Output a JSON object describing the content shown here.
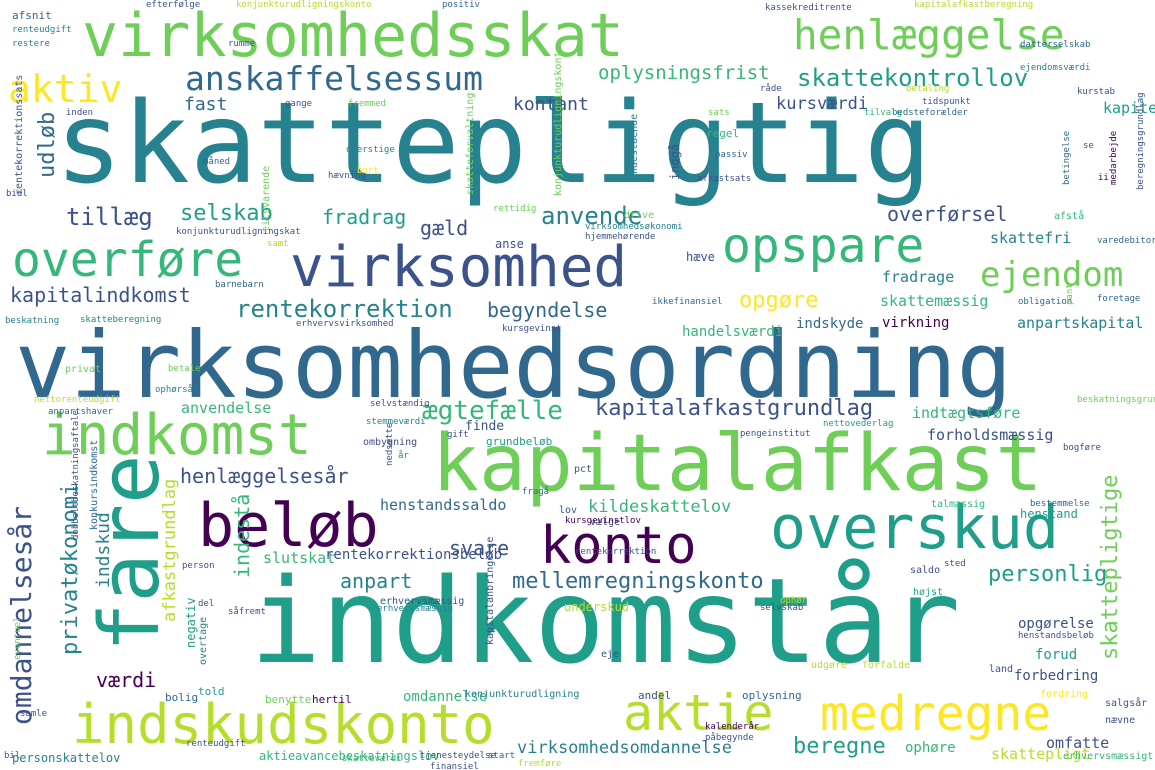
{
  "palette": {
    "dark_purple": "#440154",
    "indigo": "#3b528b",
    "blue": "#31688e",
    "teal": "#26828e",
    "teal_green": "#1f9e89",
    "green": "#35b779",
    "light_green": "#6ece58",
    "lime": "#b5de2b",
    "yellow": "#fde725"
  },
  "words": [
    {
      "text": "skattepligtig",
      "color": "#26828e"
    },
    {
      "text": "virksomhedsordning",
      "color": "#31688e"
    },
    {
      "text": "indkomstår",
      "color": "#1f9e89"
    },
    {
      "text": "kapitalafkast",
      "color": "#6ece58"
    },
    {
      "text": "virksomhedsskat",
      "color": "#6ece58"
    },
    {
      "text": "virksomhed",
      "color": "#3b528b"
    },
    {
      "text": "henlæggelse",
      "color": "#6ece58"
    },
    {
      "text": "anskaffelsessum",
      "color": "#31688e"
    },
    {
      "text": "overføre",
      "color": "#35b779"
    },
    {
      "text": "opspare",
      "color": "#35b779"
    },
    {
      "text": "indkomst",
      "color": "#6ece58"
    },
    {
      "text": "fare",
      "color": "#1f9e89"
    },
    {
      "text": "beløb",
      "color": "#440154"
    },
    {
      "text": "konto",
      "color": "#440154"
    },
    {
      "text": "overskud",
      "color": "#1f9e89"
    },
    {
      "text": "indskudskonto",
      "color": "#b5de2b"
    },
    {
      "text": "aktie",
      "color": "#b5de2b"
    },
    {
      "text": "medregne",
      "color": "#fde725"
    },
    {
      "text": "aktiv",
      "color": "#fde725"
    },
    {
      "text": "ejendom",
      "color": "#6ece58"
    },
    {
      "text": "skattekontrollov",
      "color": "#1f9e89"
    },
    {
      "text": "oplysningsfrist",
      "color": "#35b779"
    },
    {
      "text": "kontant",
      "color": "#3b528b"
    },
    {
      "text": "fast",
      "color": "#31688e"
    },
    {
      "text": "kursværdi",
      "color": "#3b528b"
    },
    {
      "text": "kapitel",
      "color": "#1f9e89"
    },
    {
      "text": "udløb",
      "color": "#31688e"
    },
    {
      "text": "tillæg",
      "color": "#3b528b"
    },
    {
      "text": "selskab",
      "color": "#1f9e89"
    },
    {
      "text": "fradrag",
      "color": "#1f9e89"
    },
    {
      "text": "gæld",
      "color": "#3b528b"
    },
    {
      "text": "anvende",
      "color": "#26828e"
    },
    {
      "text": "overførsel",
      "color": "#3b528b"
    },
    {
      "text": "skattefri",
      "color": "#26828e"
    },
    {
      "text": "kapitalindkomst",
      "color": "#3b528b"
    },
    {
      "text": "rentekorrektion",
      "color": "#26828e"
    },
    {
      "text": "begyndelse",
      "color": "#31688e"
    },
    {
      "text": "opgøre",
      "color": "#fde725"
    },
    {
      "text": "skattemæssig",
      "color": "#35b779"
    },
    {
      "text": "fradrage",
      "color": "#26828e"
    },
    {
      "text": "anpartskapital",
      "color": "#26828e"
    },
    {
      "text": "handelsværdi",
      "color": "#35b779"
    },
    {
      "text": "indskyde",
      "color": "#31688e"
    },
    {
      "text": "virkning",
      "color": "#440154"
    },
    {
      "text": "ægtefælle",
      "color": "#35b779"
    },
    {
      "text": "kapitalafkastgrundlag",
      "color": "#3b528b"
    },
    {
      "text": "indtægtsføre",
      "color": "#35b779"
    },
    {
      "text": "forholdsmæssig",
      "color": "#3b528b"
    },
    {
      "text": "anvendelse",
      "color": "#35b779"
    },
    {
      "text": "henlæggelsesår",
      "color": "#3b528b"
    },
    {
      "text": "omdannelsesår",
      "color": "#3b528b"
    },
    {
      "text": "privatøkonomi",
      "color": "#26828e"
    },
    {
      "text": "indskud",
      "color": "#26828e"
    },
    {
      "text": "afkastgrundlag",
      "color": "#b5de2b"
    },
    {
      "text": "svare",
      "color": "#3b528b"
    },
    {
      "text": "anpart",
      "color": "#26828e"
    },
    {
      "text": "mellemregningskonto",
      "color": "#31688e"
    },
    {
      "text": "personlig",
      "color": "#1f9e89"
    },
    {
      "text": "skattepligtige",
      "color": "#6ece58"
    },
    {
      "text": "henstandssaldo",
      "color": "#31688e"
    },
    {
      "text": "kildeskattelov",
      "color": "#35b779"
    },
    {
      "text": "slutskat",
      "color": "#35b779"
    },
    {
      "text": "rentekorrektionsbeløb",
      "color": "#3b528b"
    },
    {
      "text": "indestå",
      "color": "#35b779"
    },
    {
      "text": "værdi",
      "color": "#440154"
    },
    {
      "text": "beregne",
      "color": "#1f9e89"
    },
    {
      "text": "virksomhedsomdannelse",
      "color": "#26828e"
    },
    {
      "text": "omfatte",
      "color": "#3b528b"
    },
    {
      "text": "ophøre",
      "color": "#35b779"
    },
    {
      "text": "skattepligt",
      "color": "#b5de2b"
    },
    {
      "text": "opgørelse",
      "color": "#3b528b"
    },
    {
      "text": "forud",
      "color": "#1f9e89"
    },
    {
      "text": "forbedring",
      "color": "#3b528b"
    },
    {
      "text": "omdannelse",
      "color": "#35b779"
    },
    {
      "text": "aktieavancebeskatningslov",
      "color": "#35b779"
    },
    {
      "text": "personskattelov",
      "color": "#26828e"
    },
    {
      "text": "tjenesteydelse",
      "color": "#3b528b"
    },
    {
      "text": "finansiel",
      "color": "#3b528b"
    },
    {
      "text": "kalenderår",
      "color": "#440154"
    },
    {
      "text": "påbegynde",
      "color": "#3b528b"
    },
    {
      "text": "underskud",
      "color": "#b5de2b"
    },
    {
      "text": "udgøre",
      "color": "#b5de2b"
    },
    {
      "text": "forfalde",
      "color": "#b5de2b"
    },
    {
      "text": "andel",
      "color": "#3b528b"
    },
    {
      "text": "oplysning",
      "color": "#31688e"
    },
    {
      "text": "hertil",
      "color": "#440154"
    },
    {
      "text": "benytte",
      "color": "#6ece58"
    },
    {
      "text": "bolig",
      "color": "#31688e"
    },
    {
      "text": "told",
      "color": "#1f9e89"
    },
    {
      "text": "negativ",
      "color": "#1f9e89"
    },
    {
      "text": "overtage",
      "color": "#26828e"
    },
    {
      "text": "konjunkturudligning",
      "color": "#26828e"
    },
    {
      "text": "kapitalanbringelse",
      "color": "#3b528b"
    },
    {
      "text": "erhvervsmæssig",
      "color": "#3b528b"
    },
    {
      "text": "eje",
      "color": "#3b528b"
    },
    {
      "text": "land",
      "color": "#3b528b"
    },
    {
      "text": "salgsår",
      "color": "#3b528b"
    },
    {
      "text": "nævne",
      "color": "#3b528b"
    },
    {
      "text": "erhvervsmæssigt",
      "color": "#35b779"
    },
    {
      "text": "fordring",
      "color": "#fde725"
    },
    {
      "text": "højst",
      "color": "#1f9e89"
    },
    {
      "text": "saldo",
      "color": "#3b528b"
    },
    {
      "text": "henstandsbeløb",
      "color": "#3b528b"
    },
    {
      "text": "henstand",
      "color": "#1f9e89"
    },
    {
      "text": "talmæssig",
      "color": "#35b779"
    },
    {
      "text": "bestemmelse",
      "color": "#31688e"
    },
    {
      "text": "vælge",
      "color": "#3b528b"
    },
    {
      "text": "kursgevinstlov",
      "color": "#440154"
    },
    {
      "text": "lov",
      "color": "#3b528b"
    },
    {
      "text": "pct",
      "color": "#3b528b"
    },
    {
      "text": "fragå",
      "color": "#31688e"
    },
    {
      "text": "finde",
      "color": "#3b528b"
    },
    {
      "text": "grundbeløb",
      "color": "#1f9e89"
    },
    {
      "text": "ombygning",
      "color": "#3b528b"
    },
    {
      "text": "gift",
      "color": "#3b528b"
    },
    {
      "text": "stemmeværdi",
      "color": "#26828e"
    },
    {
      "text": "selvstændig",
      "color": "#3b528b"
    },
    {
      "text": "nettovederlag",
      "color": "#1f9e89"
    },
    {
      "text": "pengeinstitut",
      "color": "#3b528b"
    },
    {
      "text": "bogføre",
      "color": "#3b528b"
    },
    {
      "text": "anse",
      "color": "#3b528b"
    },
    {
      "text": "hæve",
      "color": "#3b528b"
    },
    {
      "text": "ikkefinansiel",
      "color": "#31688e"
    },
    {
      "text": "erhvervsvirksomhed",
      "color": "#3b528b"
    },
    {
      "text": "kursgevinst",
      "color": "#3b528b"
    },
    {
      "text": "barnebarn",
      "color": "#31688e"
    },
    {
      "text": "beskatning",
      "color": "#26828e"
    },
    {
      "text": "skatteberegning",
      "color": "#26828e"
    },
    {
      "text": "betale",
      "color": "#6ece58"
    },
    {
      "text": "privat",
      "color": "#6ece58"
    },
    {
      "text": "ophørsår",
      "color": "#26828e"
    },
    {
      "text": "nettorenteudgift",
      "color": "#b5de2b"
    },
    {
      "text": "anpartshaver",
      "color": "#31688e"
    },
    {
      "text": "obligation",
      "color": "#31688e"
    },
    {
      "text": "foretage",
      "color": "#31688e"
    },
    {
      "text": "varedebitor",
      "color": "#31688e"
    },
    {
      "text": "afstå",
      "color": "#35b779"
    },
    {
      "text": "virksomhedsøkonomi",
      "color": "#26828e"
    },
    {
      "text": "hjemmehørende",
      "color": "#3b528b"
    },
    {
      "text": "konjunkturudligningskat",
      "color": "#3b528b"
    },
    {
      "text": "drive",
      "color": "#6ece58"
    },
    {
      "text": "rettidig",
      "color": "#6ece58"
    },
    {
      "text": "tilsvarende",
      "color": "#6ece58"
    },
    {
      "text": "samt",
      "color": "#b5de2b"
    },
    {
      "text": "hævning",
      "color": "#3b528b"
    },
    {
      "text": "bort",
      "color": "#fde725"
    },
    {
      "text": "overstige",
      "color": "#26828e"
    },
    {
      "text": "måned",
      "color": "#31688e"
    },
    {
      "text": "passiv",
      "color": "#31688e"
    },
    {
      "text": "afkastsats",
      "color": "#3b528b"
    },
    {
      "text": "regel",
      "color": "#35b779"
    },
    {
      "text": "indestående",
      "color": "#26828e"
    },
    {
      "text": "efterfølge",
      "color": "#3b528b"
    },
    {
      "text": "konjunkturudligningskonto",
      "color": "#b5de2b"
    },
    {
      "text": "positiv",
      "color": "#31688e"
    },
    {
      "text": "kassekreditrente",
      "color": "#3b528b"
    },
    {
      "text": "kapitalafkastberegning",
      "color": "#b5de2b"
    },
    {
      "text": "afsnit",
      "color": "#31688e"
    },
    {
      "text": "renteudgift",
      "color": "#26828e"
    },
    {
      "text": "restere",
      "color": "#26828e"
    },
    {
      "text": "rumme",
      "color": "#3b528b"
    },
    {
      "text": "datterselskab",
      "color": "#31688e"
    },
    {
      "text": "ejendomsværdi",
      "color": "#26828e"
    },
    {
      "text": "råde",
      "color": "#3b528b"
    },
    {
      "text": "kurstab",
      "color": "#3b528b"
    },
    {
      "text": "betaling",
      "color": "#b5de2b"
    },
    {
      "text": "tidspunkt",
      "color": "#3b528b"
    },
    {
      "text": "bedsteforælder",
      "color": "#31688e"
    },
    {
      "text": "tilvalg",
      "color": "#35b779"
    },
    {
      "text": "sats",
      "color": "#6ece58"
    },
    {
      "text": "fremmed",
      "color": "#6ece58"
    },
    {
      "text": "gange",
      "color": "#3b528b"
    },
    {
      "text": "inden",
      "color": "#3b528b"
    },
    {
      "text": "rentekorrektionssats",
      "color": "#3b528b"
    },
    {
      "text": "skatteforvaltning",
      "color": "#6ece58"
    },
    {
      "text": "konjunkturudligningskonto",
      "color": "#6ece58"
    },
    {
      "text": "beregningsgrundlag",
      "color": "#3b528b"
    },
    {
      "text": "medarbejde",
      "color": "#440154"
    },
    {
      "text": "ii",
      "color": "#440154"
    },
    {
      "text": "se",
      "color": "#3b528b"
    },
    {
      "text": "indgå",
      "color": "#3b528b"
    },
    {
      "text": "betingelse",
      "color": "#31688e"
    },
    {
      "text": "bidl",
      "color": "#3b528b"
    },
    {
      "text": "pant",
      "color": "#6ece58"
    },
    {
      "text": "beskatningsgrundlagsordning",
      "color": "#6ece58"
    },
    {
      "text": "rentekorrektion",
      "color": "#3b528b"
    },
    {
      "text": "sted",
      "color": "#3b528b"
    },
    {
      "text": "person",
      "color": "#3b528b"
    },
    {
      "text": "del",
      "color": "#3b528b"
    },
    {
      "text": "såfremt",
      "color": "#3b528b"
    },
    {
      "text": "selvskab",
      "color": "#3b528b"
    },
    {
      "text": "ophør",
      "color": "#b5de2b"
    },
    {
      "text": "eventuel",
      "color": "#6ece58"
    },
    {
      "text": "samle",
      "color": "#3b528b"
    },
    {
      "text": "bil",
      "color": "#3b528b"
    },
    {
      "text": "nedsætte",
      "color": "#3b528b"
    },
    {
      "text": "år",
      "color": "#26828e"
    },
    {
      "text": "dobbeltbeskatningsaftale",
      "color": "#3b528b"
    },
    {
      "text": "konkursindkomst",
      "color": "#31688e"
    },
    {
      "text": "skatteværdi",
      "color": "#35b779"
    },
    {
      "text": "fremføre",
      "color": "#b5de2b"
    },
    {
      "text": "start",
      "color": "#31688e"
    },
    {
      "text": "erhvervsmæssig",
      "color": "#26828e"
    },
    {
      "text": "renteudgift",
      "color": "#3b528b"
    }
  ]
}
